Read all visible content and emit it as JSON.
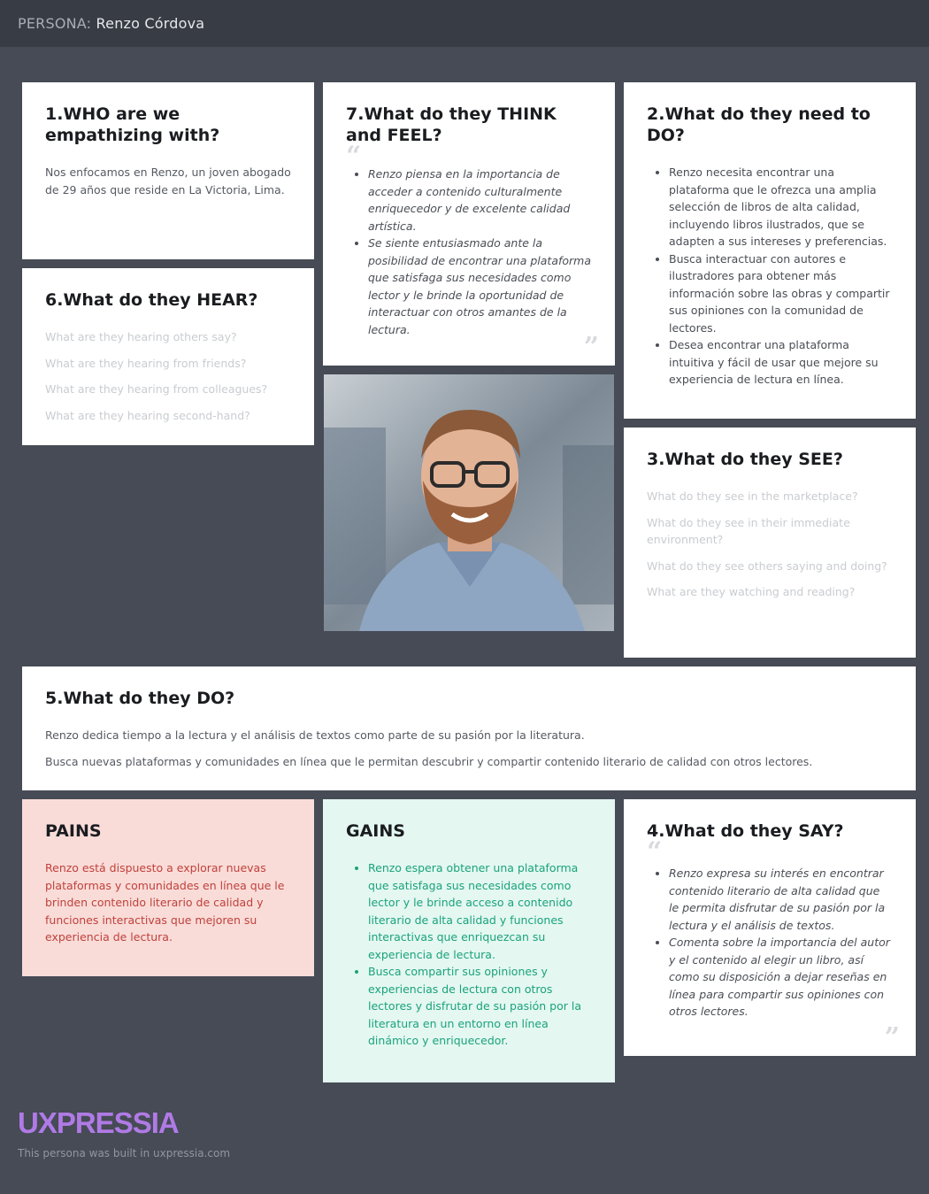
{
  "header": {
    "prefix": "PERSONA:",
    "name": "Renzo Córdova"
  },
  "who": {
    "title": "1.WHO are we empathizing with?",
    "text": "Nos enfocamos en Renzo, un joven abogado de 29 años que reside en La Victoria, Lima."
  },
  "hear": {
    "title": "6.What do they HEAR?",
    "placeholders": [
      "What are they hearing others say?",
      "What are they hearing from friends?",
      "What are they hearing  from colleagues?",
      "What are they hearing second-hand?"
    ]
  },
  "think": {
    "title": "7.What do they THINK and FEEL?",
    "items": [
      "Renzo piensa en la importancia de acceder a contenido culturalmente enriquecedor y de excelente calidad artística.",
      "Se siente entusiasmado ante la posibilidad de encontrar una plataforma que satisfaga sus necesidades como lector y le brinde la oportunidad de interactuar con otros amantes de la lectura."
    ]
  },
  "photo": {
    "alt": "Renzo Córdova portrait"
  },
  "need": {
    "title": "2.What do they need to DO?",
    "items": [
      "Renzo necesita encontrar una plataforma que le ofrezca una amplia selección de libros de alta calidad, incluyendo libros ilustrados, que se adapten a sus intereses y preferencias.",
      "Busca interactuar con autores e ilustradores para obtener más información sobre las obras y compartir sus opiniones con la comunidad de lectores.",
      "Desea encontrar una plataforma intuitiva y fácil de usar que mejore su experiencia de lectura en línea."
    ]
  },
  "see": {
    "title": "3.What do they SEE?",
    "placeholders": [
      "What do they see in the marketplace?",
      "What do they see in their immediate environment?",
      "What do they see others saying and doing?",
      "What are they watching and reading?"
    ]
  },
  "do": {
    "title": "5.What do they DO?",
    "lines": [
      "Renzo dedica tiempo a la lectura y el análisis de textos como parte de su pasión por la literatura.",
      "Busca nuevas plataformas y comunidades en línea que le permitan descubrir y compartir contenido literario de calidad con otros lectores."
    ]
  },
  "pains": {
    "title": "PAINS",
    "text": "Renzo está dispuesto a explorar nuevas plataformas y comunidades en línea que le brinden contenido literario de calidad y funciones interactivas que mejoren su experiencia de lectura."
  },
  "gains": {
    "title": "GAINS",
    "items": [
      "Renzo espera obtener una plataforma que satisfaga sus necesidades como lector y le brinde acceso a contenido literario de alta calidad y funciones interactivas que enriquezcan su experiencia de lectura.",
      "Busca compartir sus opiniones y experiencias de lectura con otros lectores y disfrutar de su pasión por la literatura en un entorno en línea dinámico y enriquecedor."
    ]
  },
  "say": {
    "title": "4.What do they SAY?",
    "items": [
      "Renzo expresa su interés en encontrar contenido literario de alta calidad que le permita disfrutar de su pasión por la lectura y el análisis de textos.",
      "Comenta sobre la importancia del autor y el contenido al elegir un libro, así como su disposición a dejar reseñas en línea para compartir sus opiniones con otros lectores."
    ]
  },
  "quotes": {
    "open": "“",
    "close": "”"
  },
  "footer": {
    "logo": "UXPRESSIA",
    "note": "This persona was built in uxpressia.com"
  }
}
